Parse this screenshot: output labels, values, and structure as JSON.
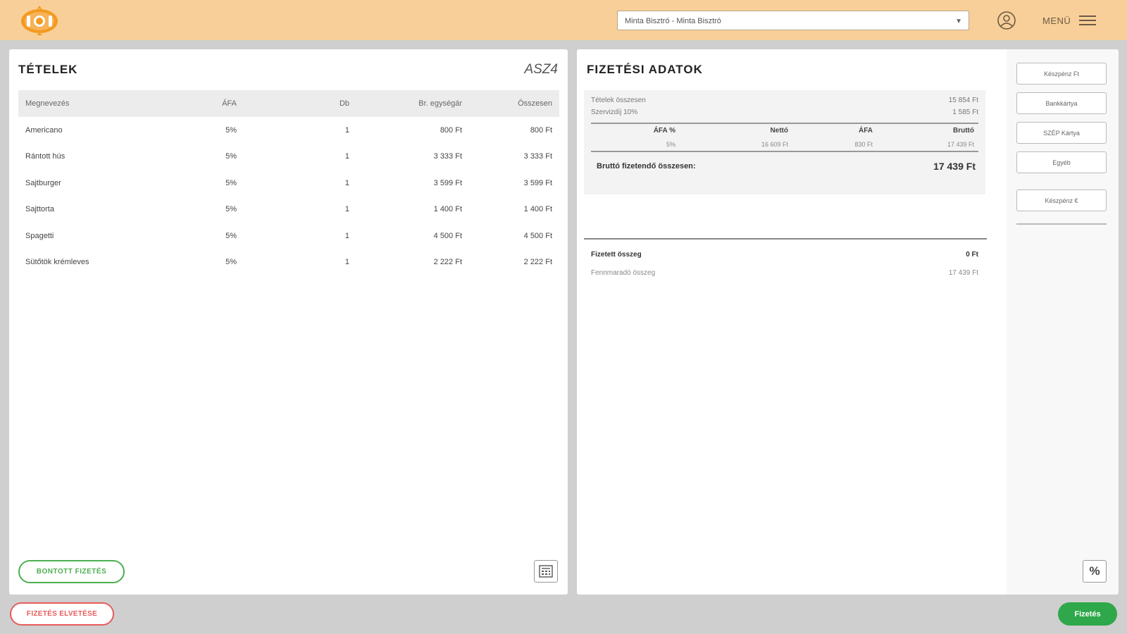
{
  "header": {
    "venue_select_value": "Minta Bisztró - Minta Bisztró",
    "menu_label": "MENÜ"
  },
  "items_panel": {
    "title": "TÉTELEK",
    "table_code": "ASZ4",
    "columns": [
      "Megnevezés",
      "ÁFA",
      "Db",
      "Br. egységár",
      "Összesen"
    ],
    "rows": [
      {
        "name": "Americano",
        "vat": "5%",
        "qty": "1",
        "unit_price": "800 Ft",
        "total": "800 Ft"
      },
      {
        "name": "Rántott hús",
        "vat": "5%",
        "qty": "1",
        "unit_price": "3 333 Ft",
        "total": "3 333 Ft"
      },
      {
        "name": "Sajtburger",
        "vat": "5%",
        "qty": "1",
        "unit_price": "3 599 Ft",
        "total": "3 599 Ft"
      },
      {
        "name": "Sajttorta",
        "vat": "5%",
        "qty": "1",
        "unit_price": "1 400 Ft",
        "total": "1 400 Ft"
      },
      {
        "name": "Spagetti",
        "vat": "5%",
        "qty": "1",
        "unit_price": "4 500 Ft",
        "total": "4 500 Ft"
      },
      {
        "name": "Sütőtök krémleves",
        "vat": "5%",
        "qty": "1",
        "unit_price": "2 222 Ft",
        "total": "2 222 Ft"
      }
    ],
    "split_payment_label": "BONTOTT FIZETÉS"
  },
  "payment_panel": {
    "title": "FIZETÉSI ADATOK",
    "items_total_label": "Tételek összesen",
    "items_total_value": "15 854 Ft",
    "service_fee_label": "Szervizdíj 10%",
    "service_fee_value": "1 585 Ft",
    "vat_columns": [
      "ÁFA %",
      "Nettó",
      "ÁFA",
      "Bruttó"
    ],
    "vat_rows": [
      {
        "rate": "5%",
        "net": "16 609 Ft",
        "vat": "830 Ft",
        "gross": "17 439 Ft"
      }
    ],
    "gross_payable_label": "Bruttó fizetendő összesen:",
    "gross_payable_value": "17 439 Ft",
    "paid_label": "Fizetett összeg",
    "paid_value": "0 Ft",
    "remaining_label": "Fennmaradó összeg",
    "remaining_value": "17 439 Ft"
  },
  "payment_methods": {
    "cash_huf": "Készpénz Ft",
    "bank_card": "Bankkártya",
    "szep_card": "SZÉP Kártya",
    "other": "Egyéb",
    "cash_eur": "Készpénz €"
  },
  "footer": {
    "discard_label": "FIZETÉS ELVETÉSE",
    "pay_label": "Fizetés"
  },
  "colors": {
    "header_bg": "#f8cf98",
    "logo_orange": "#f39a1f",
    "accent_green": "#2ea84a",
    "accent_red": "#e85a5a"
  }
}
